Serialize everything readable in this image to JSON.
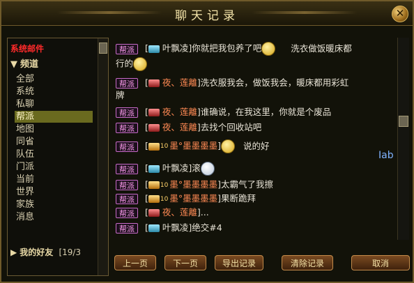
{
  "window": {
    "title": "聊天记录",
    "close_icon": "close-icon"
  },
  "sidebar": {
    "header": "系统邮件",
    "channel_label": "频道",
    "items": [
      "全部",
      "系统",
      "私聊",
      "帮派",
      "地图",
      "同省",
      "队伍",
      "门派",
      "当前",
      "世界",
      "家族",
      "消息"
    ],
    "selected": "帮派",
    "friends_label": "我的好友",
    "friends_count": "[19/3"
  },
  "chat": {
    "tag": "帮派",
    "messages": [
      {
        "name": "叶飘凌",
        "text": "你就把我包养了吧",
        "extra": "洗衣做饭暖床都",
        "wrap": "行的"
      },
      {
        "name": "夜、莲離",
        "text": "洗衣服我会，做饭我会，暖床都用彩虹",
        "wrap": "牌"
      },
      {
        "name": "夜、莲離",
        "text": "谁确说，在我这里，你就是个废品"
      },
      {
        "name": "夜、莲離",
        "text": "去找个回收站吧"
      },
      {
        "name": "墨°墨墨墨墨",
        "text": "说的好"
      },
      {
        "name": "叶飘凌",
        "text": "滚"
      },
      {
        "name": "墨°墨墨墨墨",
        "text": "太霸气了我擦"
      },
      {
        "name": "墨°墨墨墨墨",
        "text": "果断跪拜"
      },
      {
        "name": "夜、莲離",
        "text": "..."
      },
      {
        "name": "叶飘凌",
        "text": "绝交#4"
      }
    ],
    "badge_number": "10"
  },
  "buttons": {
    "prev": "上一页",
    "next": "下一页",
    "export": "导出记录",
    "clear": "清除记录",
    "cancel": "取消"
  },
  "ime_indicator": "Iab"
}
